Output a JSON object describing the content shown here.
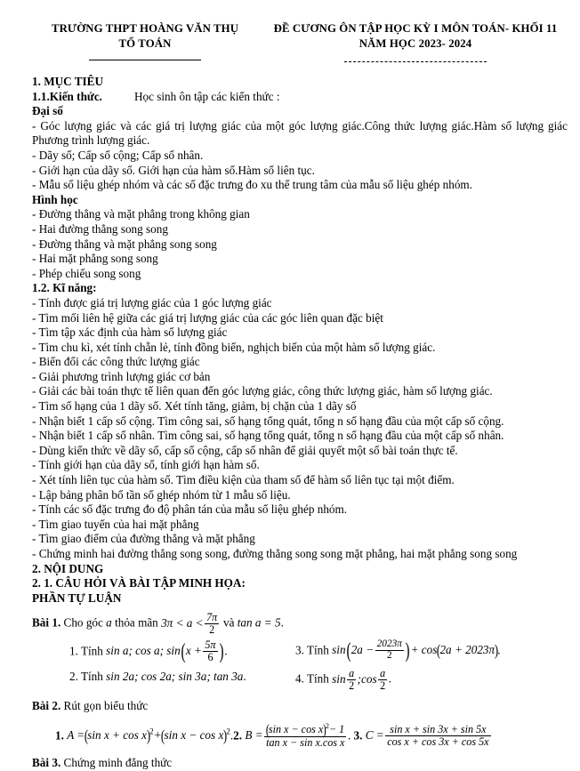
{
  "header": {
    "left": {
      "line1": "TRƯỜNG THPT HOÀNG VĂN THỤ",
      "line2": "TỔ TOÁN"
    },
    "right": {
      "line1": "ĐỀ CƯƠNG ÔN TẬP HỌC KỲ I MÔN TOÁN- KHỐI 11",
      "line2": "NĂM HỌC 2023- 2024"
    }
  },
  "sections": {
    "muc_tieu": {
      "title": "1. MỤC TIÊU",
      "kien_thuc_label": "1.1.Kiến thức.",
      "kien_thuc_text": "Học sinh ôn tập các kiến thức :",
      "dai_so_label": "Đại số",
      "dai_so_items": [
        "- Góc lượng giác và các giá trị lượng giác của một góc lượng giác.Công thức lượng giác.Hàm số lượng giác Phương trình lượng giác.",
        "- Dãy số; Cấp số cộng; Cấp số nhân.",
        "- Giới hạn của dãy số. Giới hạn của hàm số.Hàm số liên tục.",
        "- Mẫu số liệu ghép nhóm và các số đặc trưng đo xu thế trung tâm của mẫu số liệu ghép nhóm."
      ],
      "hinh_hoc_label": "Hình học",
      "hinh_hoc_items": [
        "- Đường thẳng và mặt phẳng trong không gian",
        "- Hai đường thẳng song song",
        "- Đường thẳng và mặt phẳng song song",
        "- Hai mặt phẳng song song",
        "- Phép chiếu song song"
      ],
      "ki_nang_label": "1.2. Kĩ năng:",
      "ki_nang_items": [
        "- Tính được giá trị lượng giác của 1 góc lượng giác",
        "- Tìm mối liên hệ giữa các giá trị lượng giác của các góc liên quan đặc biệt",
        "- Tìm tập xác định của hàm số lượng giác",
        "- Tìm chu kì, xét tính chẵn lẻ, tính đồng biến, nghịch biến  của một hàm số lượng giác.",
        "- Biến đổi các công thức lượng giác",
        "- Giải phương trình lượng giác cơ bản",
        "- Giải các bài toán thực tế liên quan đến góc lượng giác, công thức lượng giác, hàm số lượng giác.",
        "- Tìm số hạng của 1 dãy số.  Xét tính tăng, giảm, bị chặn của 1 dãy số",
        "- Nhận biết 1 cấp số cộng. Tìm công sai, số hạng tổng quát, tổng n số hạng đầu của một cấp số cộng.",
        "- Nhận biết 1 cấp số nhân. Tìm công sai, số hạng tổng quát, tổng n số hạng đầu của một cấp số nhân.",
        "- Dùng kiến thức về dãy số, cấp số cộng, cấp số nhân để giải quyết một số bài toán thực tế.",
        "- Tính giới hạn của dãy số, tính giới hạn hàm số.",
        "- Xét tính liên tục của hàm số. Tìm điều kiện của tham số để hàm số liên tục tại một điểm.",
        "- Lập bảng phân bố tần số ghép nhóm từ 1 mẫu số liệu.",
        "- Tính các số đặc trưng đo độ phân tán của mẫu số liệu ghép nhóm.",
        "- Tìm giao tuyến của hai mặt phẳng",
        "- Tìm giao điểm của đường thẳng và mặt phẳng",
        "- Chứng minh hai đường thẳng song song, đường thẳng song song mặt phẳng, hai mặt phẳng song song"
      ]
    },
    "noi_dung": {
      "title": "2. NỘI DUNG",
      "subtitle": "2. 1. CÂU HỎI VÀ BÀI TẬP MINH HỌA:",
      "phan_tu_luan": "PHẦN TỰ LUẬN"
    }
  },
  "exercises": {
    "bai1": {
      "label": "Bài 1.",
      "prompt": "Cho góc",
      "var": "a",
      "prompt2": "thỏa mãn",
      "cond_left": "3π < a <",
      "cond_frac_num": "7π",
      "cond_frac_den": "2",
      "cond_and": "và",
      "cond_tan": "tan a = 5",
      "cond_end": ".",
      "q1": {
        "num": "1.",
        "verb": "Tính",
        "expr_a": "sin a; cos a; sin",
        "inner_left": "x +",
        "inner_frac_num": "5π",
        "inner_frac_den": "6",
        "expr_end": "."
      },
      "q2": {
        "num": "2.",
        "verb": "Tính",
        "expr": "sin 2a; cos 2a; sin 3a; tan 3a",
        "expr_end": "."
      },
      "q3": {
        "num": "3.",
        "verb": "Tính",
        "expr_a": "sin",
        "inner_left": "2a −",
        "inner_frac_num": "2023π",
        "inner_frac_den": "2",
        "expr_b": "+ cos",
        "inner2": "2a + 2023π",
        "expr_end": "."
      },
      "q4": {
        "num": "4.",
        "verb": "Tính",
        "expr_a": "sin",
        "frac1_num": "a",
        "frac1_den": "2",
        "semi": ";",
        "expr_b": "cos",
        "frac2_num": "a",
        "frac2_den": "2",
        "expr_end": "."
      }
    },
    "bai2": {
      "label": "Bài 2.",
      "prompt": "Rút gọn biểu thức",
      "items": {
        "n1": "1.",
        "a_expr": "A = ( sin x + cos x )² + ( sin x − cos x )²",
        "a_lhs": "A =",
        "a_p1": "sin x + cos x",
        "a_plus": "+",
        "a_p2": "sin x − cos x",
        "a_dot": ".",
        "n2": "2.",
        "b_lhs": "B =",
        "b_num_paren": "sin x − cos x",
        "b_num_tail": "− 1",
        "b_den": "tan x − sin x.cos x",
        "b_dot": ".",
        "n3": "3.",
        "c_lhs": "C =",
        "c_num": "sin x + sin 3x + sin 5x",
        "c_den": "cos x + cos 3x + cos 5x"
      }
    },
    "bai3": {
      "label": "Bài 3.",
      "prompt": "Chứng minh đẳng thức"
    }
  }
}
